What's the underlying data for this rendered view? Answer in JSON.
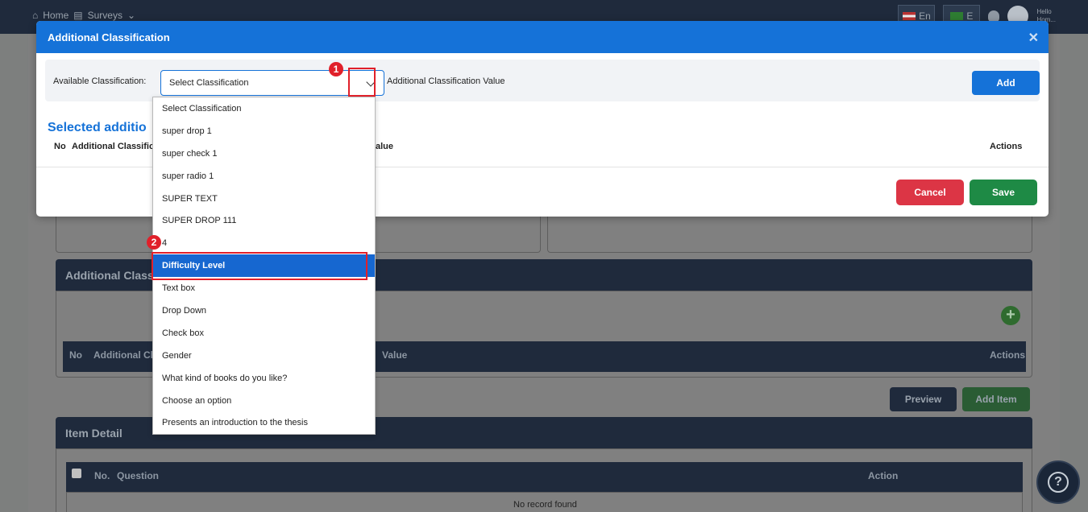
{
  "topbar": {
    "home": "Home",
    "surveys": "Surveys",
    "lang_en": "En",
    "lang_other": "E",
    "hello": "Hello",
    "username": "Hom..."
  },
  "modal": {
    "title": "Additional Classification",
    "available_label": "Available Classification:",
    "select_value": "Select Classification",
    "value_label": "Additional Classification Value",
    "add_label": "Add",
    "selected_title": "Selected additio",
    "col_no": "No",
    "col_classification": "Additional Classific",
    "col_value": "alue",
    "col_actions": "Actions",
    "cancel_label": "Cancel",
    "save_label": "Save"
  },
  "dropdown": {
    "options": [
      "Select Classification",
      "super drop 1",
      "super check 1",
      "super radio 1",
      "SUPER TEXT",
      "SUPER DROP 111",
      "4",
      "Difficulty Level",
      "Text box",
      "Drop Down",
      "Check box",
      "Gender",
      "What kind of books do you like?",
      "Choose an option",
      "Presents an introduction to the thesis"
    ],
    "highlighted_index": 7
  },
  "annotations": {
    "step1": "1",
    "step2": "2"
  },
  "background": {
    "addl_panel_title": "Additional Classif",
    "col_no": "No",
    "col_addl": "Additional Cl",
    "col_value": "Value",
    "col_actions": "Actions",
    "preview_label": "Preview",
    "add_item_label": "Add Item",
    "item_detail_title": "Item Detail",
    "col_q_no": "No.",
    "col_question": "Question",
    "col_action": "Action",
    "no_record": "No record found",
    "help": "?"
  },
  "colors": {
    "primary": "#1572d8",
    "cancel": "#dc3545",
    "save": "#1e8a45",
    "annotation": "#e0202a"
  }
}
